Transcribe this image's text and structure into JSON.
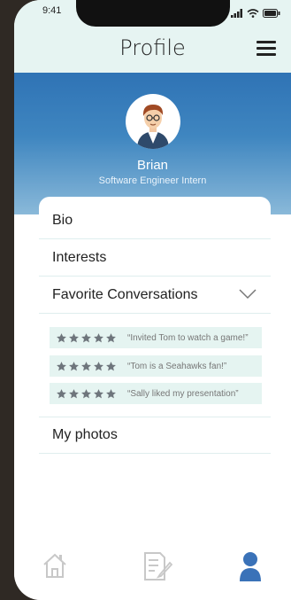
{
  "status_bar": {
    "time": "9:41"
  },
  "header": {
    "title": "Profile"
  },
  "profile": {
    "name": "Brian",
    "role": "Software Engineer Intern"
  },
  "sections": {
    "bio": "Bio",
    "interests": "Interests",
    "favorite_conversations": "Favorite Conversations",
    "my_photos": "My photos"
  },
  "conversations": [
    {
      "rating": 5,
      "quote": "“Invited Tom to watch a game!”"
    },
    {
      "rating": 5,
      "quote": "“Tom is a Seahawks fan!”"
    },
    {
      "rating": 5,
      "quote": "“Sally liked my presentation”"
    }
  ],
  "nav": {
    "items": [
      "home-icon",
      "notes-icon",
      "profile-icon"
    ],
    "active": "profile-icon"
  },
  "colors": {
    "accent": "#2f73b5",
    "header_bg": "#e6f4f2",
    "conversation_bg": "#e5f4f1",
    "nav_active": "#3a72b8",
    "nav_inactive": "#c8c8c8"
  }
}
